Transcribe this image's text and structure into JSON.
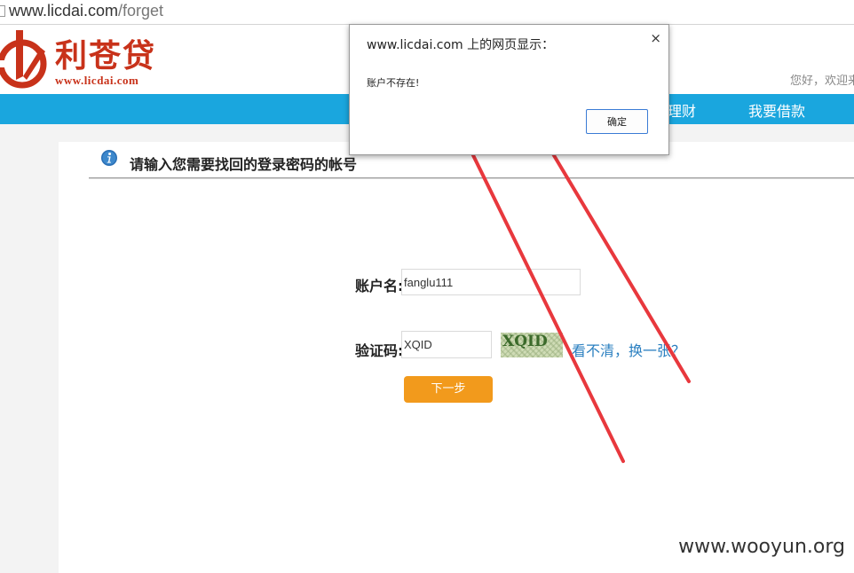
{
  "browser": {
    "url_host": "www.licdai.com",
    "url_path": "/forget"
  },
  "header": {
    "brand_name": "利苍贷",
    "brand_url": "www.licdai.com",
    "greeting": "您好，欢迎来"
  },
  "nav": {
    "items": [
      "理财",
      "我要借款"
    ]
  },
  "section": {
    "title": "请输入您需要找回的登录密码的帐号"
  },
  "form": {
    "account_label": "账户名:",
    "account_value": "fanglu111",
    "captcha_label": "验证码:",
    "captcha_value": "XQID",
    "captcha_image_text": "XQID",
    "refresh_link": "看不清，换一张？",
    "next_button": "下一步"
  },
  "dialog": {
    "title": "www.licdai.com 上的网页显示：",
    "close": "×",
    "message": "账户不存在!",
    "ok_button": "确定"
  },
  "watermark": "www.wooyun.org",
  "colors": {
    "brand_red": "#c8321a",
    "nav_blue": "#1aa6de",
    "button_orange": "#f29a1c",
    "link_blue": "#2a7fc0",
    "arrow_red": "#e8383d"
  },
  "icons": [
    "page-icon",
    "logo-icon",
    "info-icon",
    "close-icon"
  ]
}
